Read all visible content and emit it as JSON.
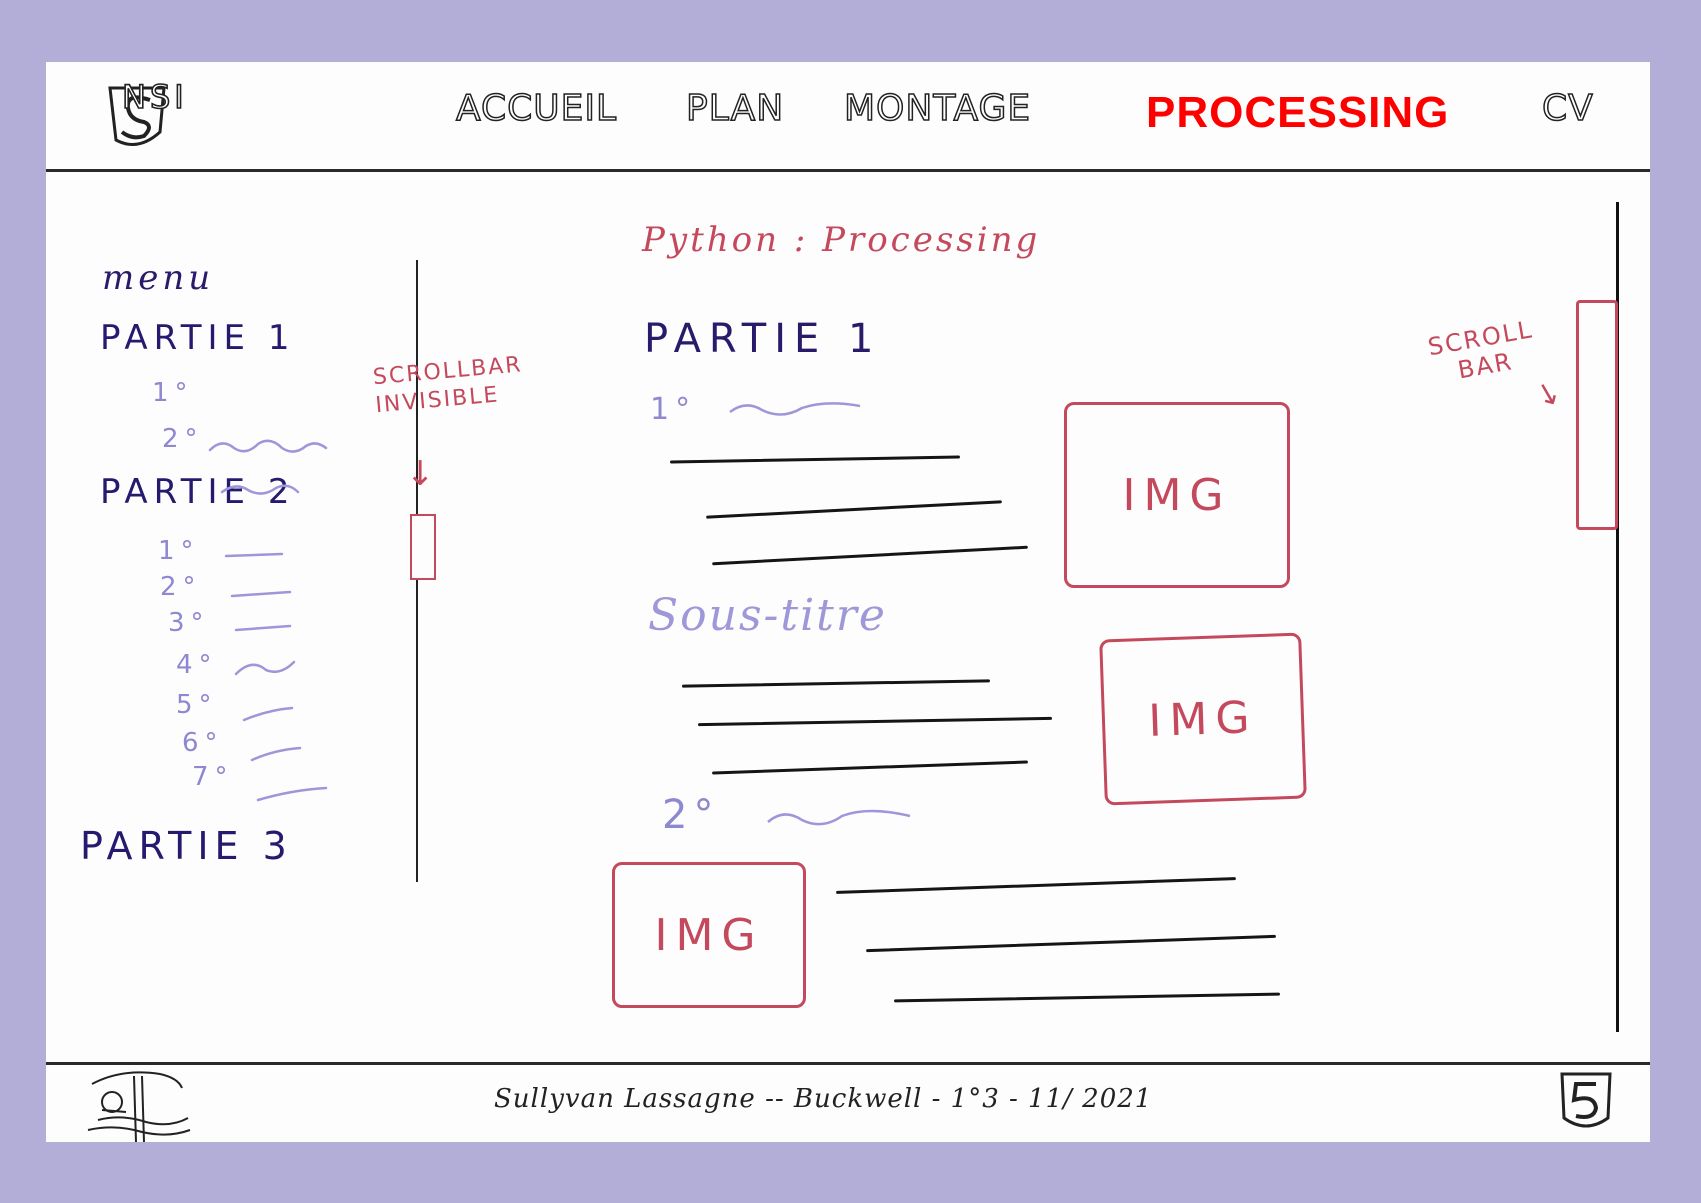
{
  "header": {
    "logo_text": "NSI",
    "nav": [
      {
        "label": "ACCUEIL"
      },
      {
        "label": "PLAN"
      },
      {
        "label": "MONTAGE"
      },
      {
        "label": "PROCESSING",
        "active": true
      },
      {
        "label": "CV"
      }
    ],
    "active_color": "#ff0000"
  },
  "menu": {
    "title": "menu",
    "parts": [
      {
        "label": "PARTIE 1",
        "subs": [
          "1°",
          "2°"
        ]
      },
      {
        "label": "PARTIE 2",
        "subs": [
          "1°",
          "2°",
          "3°",
          "4°",
          "5°",
          "6°",
          "7°"
        ]
      },
      {
        "label": "PARTIE 3",
        "subs": []
      }
    ],
    "scrollbar_note": "SCROLLBAR INVISIBLE"
  },
  "main": {
    "page_title": "Python : Processing",
    "section_title": "PARTIE 1",
    "sub_1": "1°",
    "subtitle": "Sous-titre",
    "sub_2": "2°",
    "image_label": "IMG"
  },
  "scrollbar": {
    "label": "SCROLL BAR"
  },
  "footer": {
    "text": "Sullyvan Lassagne -- Buckwell - 1°3 - 11/ 2021"
  },
  "colors": {
    "accent_red": "#c4495d",
    "ink_dark": "#251a6e",
    "ink_light": "#8e88d0",
    "background": "#b3aed8"
  }
}
